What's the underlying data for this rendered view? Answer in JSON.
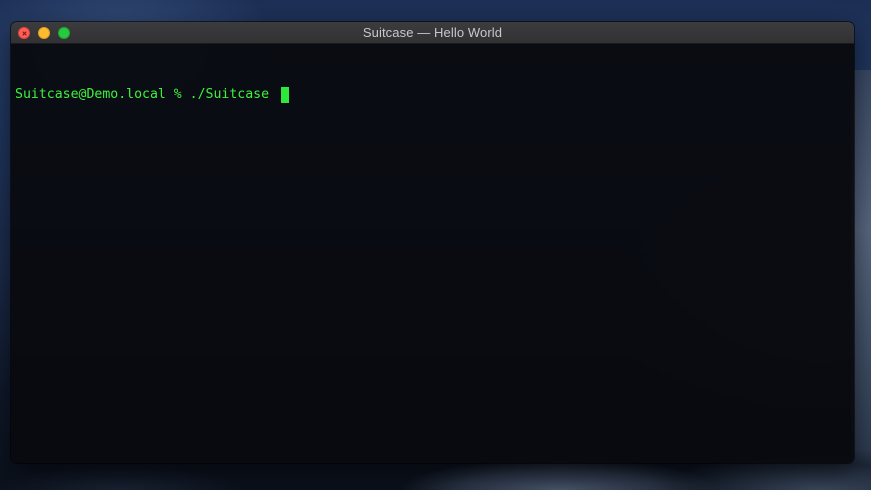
{
  "window": {
    "title": "Suitcase — Hello World"
  },
  "terminal": {
    "prompt": "Suitcase@Demo.local % ./Suitcase",
    "text_color": "#3df23d",
    "background_color": "#08090c"
  },
  "traffic_lights": {
    "close_color": "#fe5f57",
    "minimize_color": "#febc2e",
    "zoom_color": "#28c840"
  }
}
